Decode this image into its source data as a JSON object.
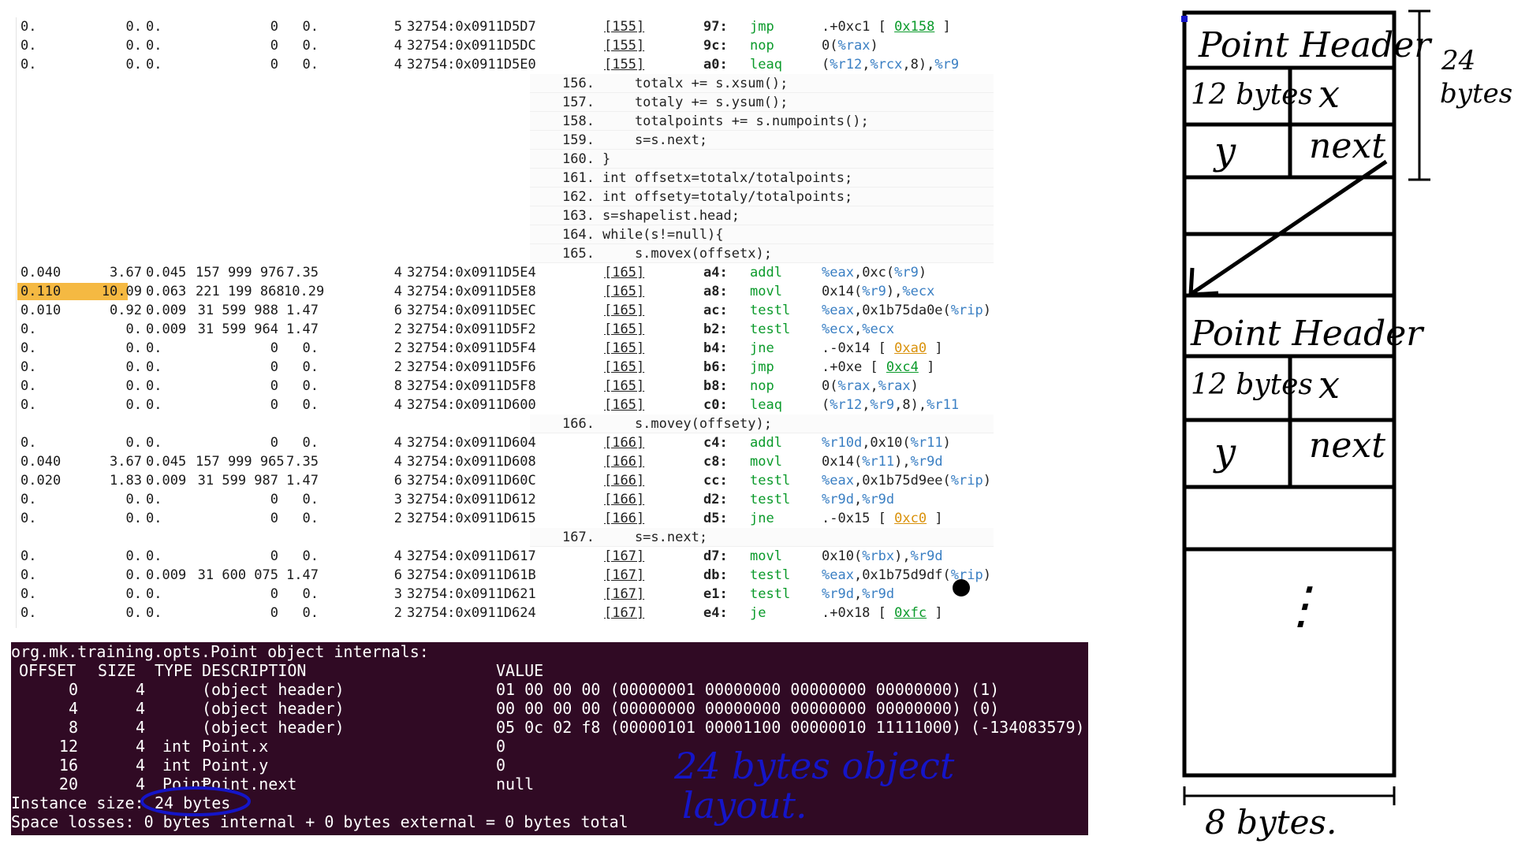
{
  "colors": {
    "terminal_bg": "#300a24",
    "highlight": "#f5b942",
    "instruction": "#0a9a2a",
    "register": "#3a7fc3",
    "jump_target": "#d9910a",
    "annotation_blue": "#1515c8"
  },
  "listing": {
    "rows": [
      {
        "kind": "asm",
        "c1": "0.",
        "c2": "0.",
        "c3": "0.",
        "c4": "0",
        "c5": "0.",
        "c6": "5",
        "c7": "32754:0x0911D5D7",
        "src": "[155]",
        "off": "97:",
        "mn": "jmp",
        "ops": [
          {
            "t": ".+0xc1 [ "
          },
          {
            "t": "0x158",
            "k": "lnk"
          },
          {
            "t": " ]"
          }
        ]
      },
      {
        "kind": "asm",
        "c1": "0.",
        "c2": "0.",
        "c3": "0.",
        "c4": "0",
        "c5": "0.",
        "c6": "4",
        "c7": "32754:0x0911D5DC",
        "src": "[155]",
        "off": "9c:",
        "mn": "nop",
        "ops": [
          {
            "t": "0("
          },
          {
            "t": "%rax",
            "k": "reg"
          },
          {
            "t": ")"
          }
        ]
      },
      {
        "kind": "asm",
        "c1": "0.",
        "c2": "0.",
        "c3": "0.",
        "c4": "0",
        "c5": "0.",
        "c6": "4",
        "c7": "32754:0x0911D5E0",
        "src": "[155]",
        "off": "a0:",
        "mn": "leaq",
        "ops": [
          {
            "t": "("
          },
          {
            "t": "%r12",
            "k": "reg"
          },
          {
            "t": ","
          },
          {
            "t": "%rcx",
            "k": "reg"
          },
          {
            "t": ",8),"
          },
          {
            "t": "%r9",
            "k": "reg"
          }
        ]
      },
      {
        "kind": "src",
        "no": "156.",
        "code": "    totalx += s.xsum();"
      },
      {
        "kind": "src",
        "no": "157.",
        "code": "    totaly += s.ysum();"
      },
      {
        "kind": "src",
        "no": "158.",
        "code": "    totalpoints += s.numpoints();"
      },
      {
        "kind": "src",
        "no": "159.",
        "code": "    s=s.next;"
      },
      {
        "kind": "src",
        "no": "160.",
        "code": "}"
      },
      {
        "kind": "src",
        "no": "161.",
        "code": "int offsetx=totalx/totalpoints;"
      },
      {
        "kind": "src",
        "no": "162.",
        "code": "int offsety=totaly/totalpoints;"
      },
      {
        "kind": "src",
        "no": "163.",
        "code": "s=shapelist.head;"
      },
      {
        "kind": "src",
        "no": "164.",
        "code": "while(s!=null){"
      },
      {
        "kind": "src",
        "no": "165.",
        "code": "    s.movex(offsetx);"
      },
      {
        "kind": "asm",
        "c1": "0.040",
        "c2": "3.67",
        "c3": "0.045",
        "c4": "157 999 976",
        "c5": "7.35",
        "c6": "4",
        "c7": "32754:0x0911D5E4",
        "src": "[165]",
        "off": "a4:",
        "mn": "addl",
        "ops": [
          {
            "t": "%eax",
            "k": "reg"
          },
          {
            "t": ",0xc("
          },
          {
            "t": "%r9",
            "k": "reg"
          },
          {
            "t": ")"
          }
        ]
      },
      {
        "kind": "asm",
        "hl": true,
        "c1": "0.110",
        "c2": "10.09",
        "c3": "0.063",
        "c4": "221 199 868",
        "c5": "10.29",
        "c6": "4",
        "c7": "32754:0x0911D5E8",
        "src": "[165]",
        "off": "a8:",
        "mn": "movl",
        "ops": [
          {
            "t": "0x14("
          },
          {
            "t": "%r9",
            "k": "reg"
          },
          {
            "t": "),"
          },
          {
            "t": "%ecx",
            "k": "reg"
          }
        ]
      },
      {
        "kind": "asm",
        "c1": "0.010",
        "c2": "0.92",
        "c3": "0.009",
        "c4": "31 599 988",
        "c5": "1.47",
        "c6": "6",
        "c7": "32754:0x0911D5EC",
        "src": "[165]",
        "off": "ac:",
        "mn": "testl",
        "ops": [
          {
            "t": "%eax",
            "k": "reg"
          },
          {
            "t": ",0x1b75da0e("
          },
          {
            "t": "%rip",
            "k": "reg"
          },
          {
            "t": ")"
          }
        ]
      },
      {
        "kind": "asm",
        "c1": "0.",
        "c2": "0.",
        "c3": "0.009",
        "c4": "31 599 964",
        "c5": "1.47",
        "c6": "2",
        "c7": "32754:0x0911D5F2",
        "src": "[165]",
        "off": "b2:",
        "mn": "testl",
        "ops": [
          {
            "t": "%ecx",
            "k": "reg"
          },
          {
            "t": ","
          },
          {
            "t": "%ecx",
            "k": "reg"
          }
        ]
      },
      {
        "kind": "asm",
        "c1": "0.",
        "c2": "0.",
        "c3": "0.",
        "c4": "0",
        "c5": "0.",
        "c6": "2",
        "c7": "32754:0x0911D5F4",
        "src": "[165]",
        "off": "b4:",
        "mn": "jne",
        "ops": [
          {
            "t": ".-0x14 [ "
          },
          {
            "t": "0xa0",
            "k": "lnk-o"
          },
          {
            "t": " ]"
          }
        ]
      },
      {
        "kind": "asm",
        "c1": "0.",
        "c2": "0.",
        "c3": "0.",
        "c4": "0",
        "c5": "0.",
        "c6": "2",
        "c7": "32754:0x0911D5F6",
        "src": "[165]",
        "off": "b6:",
        "mn": "jmp",
        "ops": [
          {
            "t": ".+0xe [ "
          },
          {
            "t": "0xc4",
            "k": "lnk"
          },
          {
            "t": " ]"
          }
        ]
      },
      {
        "kind": "asm",
        "c1": "0.",
        "c2": "0.",
        "c3": "0.",
        "c4": "0",
        "c5": "0.",
        "c6": "8",
        "c7": "32754:0x0911D5F8",
        "src": "[165]",
        "off": "b8:",
        "mn": "nop",
        "ops": [
          {
            "t": "0("
          },
          {
            "t": "%rax",
            "k": "reg"
          },
          {
            "t": ","
          },
          {
            "t": "%rax",
            "k": "reg"
          },
          {
            "t": ")"
          }
        ]
      },
      {
        "kind": "asm",
        "c1": "0.",
        "c2": "0.",
        "c3": "0.",
        "c4": "0",
        "c5": "0.",
        "c6": "4",
        "c7": "32754:0x0911D600",
        "src": "[165]",
        "off": "c0:",
        "mn": "leaq",
        "ops": [
          {
            "t": "("
          },
          {
            "t": "%r12",
            "k": "reg"
          },
          {
            "t": ","
          },
          {
            "t": "%r9",
            "k": "reg"
          },
          {
            "t": ",8),"
          },
          {
            "t": "%r11",
            "k": "reg"
          }
        ]
      },
      {
        "kind": "src",
        "no": "166.",
        "code": "    s.movey(offsety);"
      },
      {
        "kind": "asm",
        "c1": "0.",
        "c2": "0.",
        "c3": "0.",
        "c4": "0",
        "c5": "0.",
        "c6": "4",
        "c7": "32754:0x0911D604",
        "src": "[166]",
        "off": "c4:",
        "mn": "addl",
        "ops": [
          {
            "t": "%r10d",
            "k": "reg"
          },
          {
            "t": ",0x10("
          },
          {
            "t": "%r11",
            "k": "reg"
          },
          {
            "t": ")"
          }
        ]
      },
      {
        "kind": "asm",
        "c1": "0.040",
        "c2": "3.67",
        "c3": "0.045",
        "c4": "157 999 965",
        "c5": "7.35",
        "c6": "4",
        "c7": "32754:0x0911D608",
        "src": "[166]",
        "off": "c8:",
        "mn": "movl",
        "ops": [
          {
            "t": "0x14("
          },
          {
            "t": "%r11",
            "k": "reg"
          },
          {
            "t": "),"
          },
          {
            "t": "%r9d",
            "k": "reg"
          }
        ]
      },
      {
        "kind": "asm",
        "c1": "0.020",
        "c2": "1.83",
        "c3": "0.009",
        "c4": "31 599 987",
        "c5": "1.47",
        "c6": "6",
        "c7": "32754:0x0911D60C",
        "src": "[166]",
        "off": "cc:",
        "mn": "testl",
        "ops": [
          {
            "t": "%eax",
            "k": "reg"
          },
          {
            "t": ",0x1b75d9ee("
          },
          {
            "t": "%rip",
            "k": "reg"
          },
          {
            "t": ")"
          }
        ]
      },
      {
        "kind": "asm",
        "c1": "0.",
        "c2": "0.",
        "c3": "0.",
        "c4": "0",
        "c5": "0.",
        "c6": "3",
        "c7": "32754:0x0911D612",
        "src": "[166]",
        "off": "d2:",
        "mn": "testl",
        "ops": [
          {
            "t": "%r9d",
            "k": "reg"
          },
          {
            "t": ","
          },
          {
            "t": "%r9d",
            "k": "reg"
          }
        ]
      },
      {
        "kind": "asm",
        "c1": "0.",
        "c2": "0.",
        "c3": "0.",
        "c4": "0",
        "c5": "0.",
        "c6": "2",
        "c7": "32754:0x0911D615",
        "src": "[166]",
        "off": "d5:",
        "mn": "jne",
        "ops": [
          {
            "t": ".-0x15 [ "
          },
          {
            "t": "0xc0",
            "k": "lnk-o"
          },
          {
            "t": " ]"
          }
        ]
      },
      {
        "kind": "src",
        "no": "167.",
        "code": "    s=s.next;"
      },
      {
        "kind": "asm",
        "c1": "0.",
        "c2": "0.",
        "c3": "0.",
        "c4": "0",
        "c5": "0.",
        "c6": "4",
        "c7": "32754:0x0911D617",
        "src": "[167]",
        "off": "d7:",
        "mn": "movl",
        "ops": [
          {
            "t": "0x10("
          },
          {
            "t": "%rbx",
            "k": "reg"
          },
          {
            "t": "),"
          },
          {
            "t": "%r9d",
            "k": "reg"
          }
        ]
      },
      {
        "kind": "asm",
        "c1": "0.",
        "c2": "0.",
        "c3": "0.009",
        "c4": "31 600 075",
        "c5": "1.47",
        "c6": "6",
        "c7": "32754:0x0911D61B",
        "src": "[167]",
        "off": "db:",
        "mn": "testl",
        "ops": [
          {
            "t": "%eax",
            "k": "reg"
          },
          {
            "t": ",0x1b75d9df("
          },
          {
            "t": "%rip",
            "k": "reg"
          },
          {
            "t": ")"
          }
        ]
      },
      {
        "kind": "asm",
        "c1": "0.",
        "c2": "0.",
        "c3": "0.",
        "c4": "0",
        "c5": "0.",
        "c6": "3",
        "c7": "32754:0x0911D621",
        "src": "[167]",
        "off": "e1:",
        "mn": "testl",
        "ops": [
          {
            "t": "%r9d",
            "k": "reg"
          },
          {
            "t": ","
          },
          {
            "t": "%r9d",
            "k": "reg"
          }
        ]
      },
      {
        "kind": "asm",
        "c1": "0.",
        "c2": "0.",
        "c3": "0.",
        "c4": "0",
        "c5": "0.",
        "c6": "2",
        "c7": "32754:0x0911D624",
        "src": "[167]",
        "off": "e4:",
        "mn": "je",
        "ops": [
          {
            "t": ".+0x18 [ "
          },
          {
            "t": "0xfc",
            "k": "lnk"
          },
          {
            "t": " ]"
          }
        ]
      }
    ]
  },
  "terminal": {
    "title": "org.mk.training.opts.Point object internals:",
    "headers": {
      "offset": "OFFSET",
      "size": "SIZE",
      "type": "TYPE",
      "description": "DESCRIPTION",
      "value": "VALUE"
    },
    "rows": [
      {
        "offset": "0",
        "size": "4",
        "type": "",
        "description": "(object header)",
        "value": "01 00 00 00 (00000001 00000000 00000000 00000000) (1)"
      },
      {
        "offset": "4",
        "size": "4",
        "type": "",
        "description": "(object header)",
        "value": "00 00 00 00 (00000000 00000000 00000000 00000000) (0)"
      },
      {
        "offset": "8",
        "size": "4",
        "type": "",
        "description": "(object header)",
        "value": "05 0c 02 f8 (00000101 00001100 00000010 11111000) (-134083579)"
      },
      {
        "offset": "12",
        "size": "4",
        "type": "int",
        "description": "Point.x",
        "value": "0"
      },
      {
        "offset": "16",
        "size": "4",
        "type": "int",
        "description": "Point.y",
        "value": "0"
      },
      {
        "offset": "20",
        "size": "4",
        "type": "Point",
        "description": "Point.next",
        "value": "null"
      }
    ],
    "instance_size_label": "Instance size:",
    "instance_size_value": "24 bytes",
    "space_losses": "Space losses: 0 bytes internal + 0 bytes external = 0 bytes total"
  },
  "annotations": {
    "layout_note_line1": "24 bytes object",
    "layout_note_line2": "layout.",
    "diagram": {
      "header_label": "Point Header",
      "bytes_label": "12 bytes",
      "x_label": "x",
      "y_label": "y",
      "next_label": "next",
      "ellipsis": "⋮",
      "dimension_height_line1": "24",
      "dimension_height_line2": "bytes",
      "dimension_width": "8 bytes."
    }
  }
}
